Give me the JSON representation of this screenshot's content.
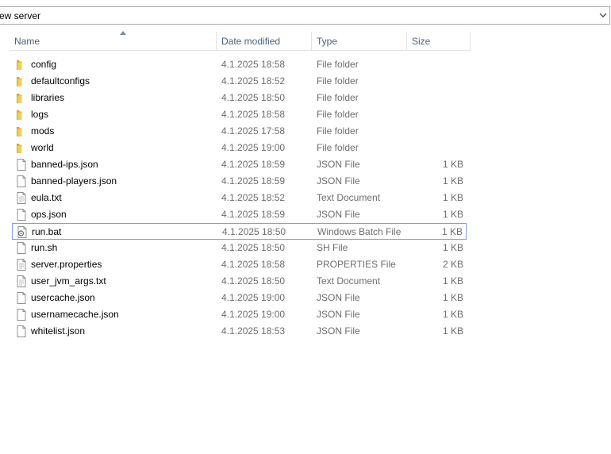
{
  "address": {
    "path": "ew server"
  },
  "columns": {
    "name": "Name",
    "date": "Date modified",
    "type": "Type",
    "size": "Size"
  },
  "files": [
    {
      "name": "config",
      "date": "4.1.2025 18:58",
      "type": "File folder",
      "size": "",
      "icon": "folder-icon"
    },
    {
      "name": "defaultconfigs",
      "date": "4.1.2025 18:52",
      "type": "File folder",
      "size": "",
      "icon": "folder-icon"
    },
    {
      "name": "libraries",
      "date": "4.1.2025 18:50",
      "type": "File folder",
      "size": "",
      "icon": "folder-icon"
    },
    {
      "name": "logs",
      "date": "4.1.2025 18:58",
      "type": "File folder",
      "size": "",
      "icon": "folder-icon"
    },
    {
      "name": "mods",
      "date": "4.1.2025 17:58",
      "type": "File folder",
      "size": "",
      "icon": "folder-icon"
    },
    {
      "name": "world",
      "date": "4.1.2025 19:00",
      "type": "File folder",
      "size": "",
      "icon": "folder-icon"
    },
    {
      "name": "banned-ips.json",
      "date": "4.1.2025 18:59",
      "type": "JSON File",
      "size": "1 KB",
      "icon": "file-icon"
    },
    {
      "name": "banned-players.json",
      "date": "4.1.2025 18:59",
      "type": "JSON File",
      "size": "1 KB",
      "icon": "file-icon"
    },
    {
      "name": "eula.txt",
      "date": "4.1.2025 18:52",
      "type": "Text Document",
      "size": "1 KB",
      "icon": "text-file-icon"
    },
    {
      "name": "ops.json",
      "date": "4.1.2025 18:59",
      "type": "JSON File",
      "size": "1 KB",
      "icon": "file-icon"
    },
    {
      "name": "run.bat",
      "date": "4.1.2025 18:50",
      "type": "Windows Batch File",
      "size": "1 KB",
      "icon": "batch-file-icon",
      "selected": true
    },
    {
      "name": "run.sh",
      "date": "4.1.2025 18:50",
      "type": "SH File",
      "size": "1 KB",
      "icon": "file-icon"
    },
    {
      "name": "server.properties",
      "date": "4.1.2025 18:58",
      "type": "PROPERTIES File",
      "size": "2 KB",
      "icon": "text-file-icon"
    },
    {
      "name": "user_jvm_args.txt",
      "date": "4.1.2025 18:50",
      "type": "Text Document",
      "size": "1 KB",
      "icon": "text-file-icon"
    },
    {
      "name": "usercache.json",
      "date": "4.1.2025 19:00",
      "type": "JSON File",
      "size": "1 KB",
      "icon": "file-icon"
    },
    {
      "name": "usernamecache.json",
      "date": "4.1.2025 19:00",
      "type": "JSON File",
      "size": "1 KB",
      "icon": "file-icon"
    },
    {
      "name": "whitelist.json",
      "date": "4.1.2025 18:53",
      "type": "JSON File",
      "size": "1 KB",
      "icon": "file-icon"
    }
  ],
  "colors": {
    "header_text": "#4c607a",
    "meta_text": "#6d6d6d",
    "selection_border": "#7da2ce",
    "folder": "#e8c046"
  }
}
